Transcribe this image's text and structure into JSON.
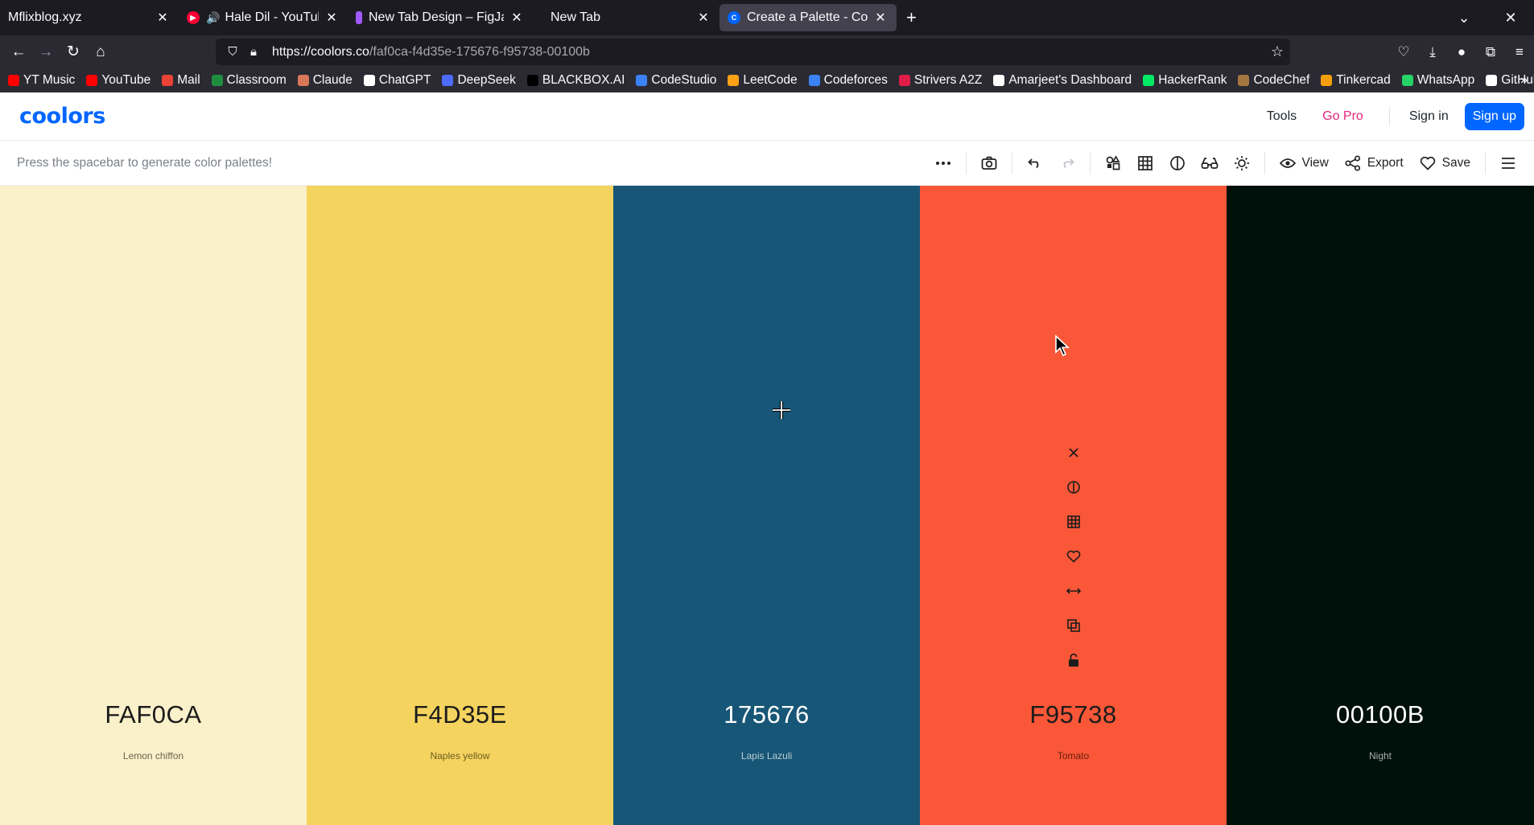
{
  "browser": {
    "tabs": [
      {
        "title": "Mflixblog.xyz",
        "active": false
      },
      {
        "title": "Hale Dil - YouTube Mu",
        "active": false
      },
      {
        "title": "New Tab Design – FigJar",
        "active": false
      },
      {
        "title": "New Tab",
        "active": false
      },
      {
        "title": "Create a Palette - Coolor",
        "active": true
      }
    ],
    "url": {
      "host": "https://coolors.co",
      "path": "/faf0ca-f4d35e-175676-f95738-00100b"
    },
    "bookmarks": [
      {
        "label": "YT Music",
        "color": "#ff0000"
      },
      {
        "label": "YouTube",
        "color": "#ff0000"
      },
      {
        "label": "Mail",
        "color": "#ea4335"
      },
      {
        "label": "Classroom",
        "color": "#1e8e3e"
      },
      {
        "label": "Claude",
        "color": "#d97757"
      },
      {
        "label": "ChatGPT",
        "color": "#ffffff"
      },
      {
        "label": "DeepSeek",
        "color": "#4d6bfe"
      },
      {
        "label": "BLACKBOX.AI",
        "color": "#000000"
      },
      {
        "label": "CodeStudio",
        "color": "#3b82f6"
      },
      {
        "label": "LeetCode",
        "color": "#ffa116"
      },
      {
        "label": "Codeforces",
        "color": "#3b82f6"
      },
      {
        "label": "Strivers A2Z",
        "color": "#e11d48"
      },
      {
        "label": "Amarjeet's Dashboard",
        "color": "#ffffff"
      },
      {
        "label": "HackerRank",
        "color": "#00ea64"
      },
      {
        "label": "CodeChef",
        "color": "#a3773f"
      },
      {
        "label": "Tinkercad",
        "color": "#f59e0b"
      },
      {
        "label": "WhatsApp",
        "color": "#25d366"
      },
      {
        "label": "GitHub",
        "color": "#ffffff"
      }
    ]
  },
  "app": {
    "logo": "coolors",
    "nav": {
      "tools": "Tools",
      "go_pro": "Go Pro",
      "sign_in": "Sign in",
      "sign_up": "Sign up"
    },
    "hint": "Press the spacebar to generate color palettes!",
    "toolbar": {
      "view": "View",
      "export": "Export",
      "save": "Save"
    },
    "accent": "#0066ff",
    "pro_color": "#e3277f"
  },
  "palette": [
    {
      "hex": "FAF0CA",
      "name": "Lemon chiffon",
      "color": "#faf0ca",
      "text": "#1c1c1c",
      "sub": "#6d6650"
    },
    {
      "hex": "F4D35E",
      "name": "Naples yellow",
      "color": "#f4d35e",
      "text": "#1c1c1c",
      "sub": "#6e5c20"
    },
    {
      "hex": "175676",
      "name": "Lapis Lazuli",
      "color": "#175676",
      "text": "#ffffff",
      "sub": "#b9ccd6"
    },
    {
      "hex": "F95738",
      "name": "Tomato",
      "color": "#f95738",
      "text": "#1c1c1c",
      "sub": "#6a2011"
    },
    {
      "hex": "00100B",
      "name": "Night",
      "color": "#00100b",
      "text": "#ffffff",
      "sub": "#a7b0ad"
    }
  ]
}
